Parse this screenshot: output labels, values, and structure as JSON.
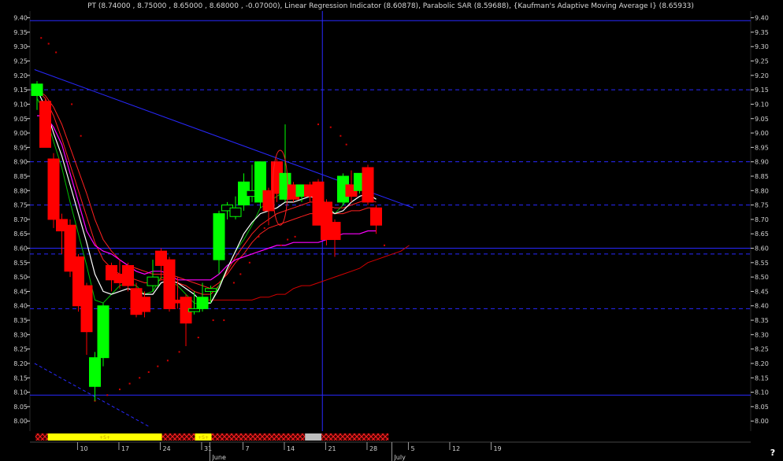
{
  "header": {
    "text": "PT (8.74000 , 8.75000 , 8.65000 , 8.68000 , -0.07000), Linear Regression Indicator (8.60878), Parabolic SAR (8.59688), {Kaufman's Adaptive Moving Average I} (8.65933)"
  },
  "corner_label": "?",
  "colors": {
    "background": "#000000",
    "up_candle": "#00ff00",
    "down_candle": "#ff0000",
    "trendline": "#2828ff",
    "linreg": "#00c000",
    "kama": "#ff00ff",
    "sar": "#d40000",
    "ma_white": "#ffffff",
    "ma_red": "#ff2020",
    "volume_yellow": "#ffff00",
    "volume_gray": "#bdbdbd"
  },
  "chart_data": {
    "type": "candlestick",
    "ylim": [
      7.95,
      9.43
    ],
    "y_ticks": [
      "9.40",
      "9.35",
      "9.30",
      "9.25",
      "9.20",
      "9.15",
      "9.10",
      "9.05",
      "9.00",
      "8.95",
      "8.90",
      "8.85",
      "8.80",
      "8.75",
      "8.70",
      "8.65",
      "8.60",
      "8.55",
      "8.50",
      "8.45",
      "8.40",
      "8.35",
      "8.30",
      "8.25",
      "8.20",
      "8.15",
      "8.10",
      "8.05",
      "8.00"
    ],
    "x_labels": [
      {
        "label": "10",
        "bar": 5
      },
      {
        "label": "17",
        "bar": 10
      },
      {
        "label": "24",
        "bar": 15
      },
      {
        "label": "31",
        "bar": 20
      },
      {
        "label": "June",
        "bar": 21
      },
      {
        "label": "7",
        "bar": 25
      },
      {
        "label": "14",
        "bar": 30
      },
      {
        "label": "21",
        "bar": 35
      },
      {
        "label": "28",
        "bar": 40
      },
      {
        "label": "July",
        "bar": 43
      },
      {
        "label": "5",
        "bar": 45
      },
      {
        "label": "12",
        "bar": 50
      },
      {
        "label": "19",
        "bar": 55
      }
    ],
    "candles": [
      {
        "o": 9.13,
        "h": 9.18,
        "l": 9.08,
        "c": 9.17
      },
      {
        "o": 9.11,
        "h": 9.12,
        "l": 8.95,
        "c": 8.95
      },
      {
        "o": 8.91,
        "h": 8.93,
        "l": 8.67,
        "c": 8.7
      },
      {
        "o": 8.7,
        "h": 8.72,
        "l": 8.58,
        "c": 8.66
      },
      {
        "o": 8.68,
        "h": 8.7,
        "l": 8.5,
        "c": 8.52
      },
      {
        "o": 8.57,
        "h": 8.58,
        "l": 8.38,
        "c": 8.4
      },
      {
        "o": 8.47,
        "h": 8.48,
        "l": 8.23,
        "c": 8.31
      },
      {
        "o": 8.12,
        "h": 8.24,
        "l": 8.07,
        "c": 8.22
      },
      {
        "o": 8.22,
        "h": 8.41,
        "l": 8.19,
        "c": 8.4
      },
      {
        "o": 8.54,
        "h": 8.55,
        "l": 8.45,
        "c": 8.49
      },
      {
        "o": 8.51,
        "h": 8.56,
        "l": 8.46,
        "c": 8.48
      },
      {
        "o": 8.54,
        "h": 8.55,
        "l": 8.45,
        "c": 8.47
      },
      {
        "o": 8.46,
        "h": 8.48,
        "l": 8.36,
        "c": 8.37
      },
      {
        "o": 8.43,
        "h": 8.45,
        "l": 8.36,
        "c": 8.38
      },
      {
        "o": 8.47,
        "h": 8.56,
        "l": 8.45,
        "c": 8.5
      },
      {
        "o": 8.59,
        "h": 8.6,
        "l": 8.49,
        "c": 8.54
      },
      {
        "o": 8.56,
        "h": 8.57,
        "l": 8.38,
        "c": 8.39
      },
      {
        "o": 8.42,
        "h": 8.5,
        "l": 8.39,
        "c": 8.41
      },
      {
        "o": 8.43,
        "h": 8.44,
        "l": 8.26,
        "c": 8.34
      },
      {
        "o": 8.38,
        "h": 8.45,
        "l": 8.37,
        "c": 8.39
      },
      {
        "o": 8.39,
        "h": 8.48,
        "l": 8.38,
        "c": 8.43
      },
      {
        "o": 8.45,
        "h": 8.47,
        "l": 8.41,
        "c": 8.46
      },
      {
        "o": 8.56,
        "h": 8.73,
        "l": 8.51,
        "c": 8.72
      },
      {
        "o": 8.73,
        "h": 8.76,
        "l": 8.7,
        "c": 8.75
      },
      {
        "o": 8.71,
        "h": 8.78,
        "l": 8.7,
        "c": 8.74
      },
      {
        "o": 8.75,
        "h": 8.86,
        "l": 8.73,
        "c": 8.83
      },
      {
        "o": 8.78,
        "h": 8.89,
        "l": 8.76,
        "c": 8.8
      },
      {
        "o": 8.76,
        "h": 8.9,
        "l": 8.74,
        "c": 8.9
      },
      {
        "o": 8.8,
        "h": 8.81,
        "l": 8.68,
        "c": 8.73
      },
      {
        "o": 8.9,
        "h": 8.91,
        "l": 8.76,
        "c": 8.79
      },
      {
        "o": 8.77,
        "h": 9.03,
        "l": 8.76,
        "c": 8.86
      },
      {
        "o": 8.82,
        "h": 8.83,
        "l": 8.76,
        "c": 8.77
      },
      {
        "o": 8.78,
        "h": 8.81,
        "l": 8.76,
        "c": 8.82
      },
      {
        "o": 8.82,
        "h": 8.83,
        "l": 8.76,
        "c": 8.78
      },
      {
        "o": 8.83,
        "h": 8.84,
        "l": 8.68,
        "c": 8.68
      },
      {
        "o": 8.76,
        "h": 8.77,
        "l": 8.61,
        "c": 8.63
      },
      {
        "o": 8.69,
        "h": 8.7,
        "l": 8.57,
        "c": 8.63
      },
      {
        "o": 8.76,
        "h": 8.86,
        "l": 8.75,
        "c": 8.85
      },
      {
        "o": 8.82,
        "h": 8.87,
        "l": 8.76,
        "c": 8.78
      },
      {
        "o": 8.8,
        "h": 8.86,
        "l": 8.79,
        "c": 8.86
      },
      {
        "o": 8.88,
        "h": 8.89,
        "l": 8.75,
        "c": 8.76
      },
      {
        "o": 8.74,
        "h": 8.75,
        "l": 8.65,
        "c": 8.68
      }
    ],
    "linreg": [
      9.12,
      9.07,
      8.97,
      8.88,
      8.76,
      8.65,
      8.54,
      8.42,
      8.41,
      8.44,
      8.47,
      8.48,
      8.47,
      8.44,
      8.45,
      8.5,
      8.49,
      8.47,
      8.44,
      8.41,
      8.4,
      8.41,
      8.47,
      8.53,
      8.59,
      8.63,
      8.68,
      8.74,
      8.76,
      8.78,
      8.8,
      8.8,
      8.8,
      8.81,
      8.79,
      8.75,
      8.72,
      8.75,
      8.79,
      8.81,
      8.79,
      8.77
    ],
    "kama": [
      9.06,
      9.06,
      9.02,
      8.96,
      8.86,
      8.76,
      8.66,
      8.61,
      8.59,
      8.58,
      8.56,
      8.54,
      8.52,
      8.51,
      8.52,
      8.52,
      8.51,
      8.49,
      8.49,
      8.49,
      8.49,
      8.49,
      8.51,
      8.54,
      8.56,
      8.57,
      8.58,
      8.59,
      8.6,
      8.61,
      8.61,
      8.62,
      8.62,
      8.62,
      8.62,
      8.63,
      8.64,
      8.65,
      8.65,
      8.65,
      8.66,
      8.66
    ],
    "ma_white": [
      9.15,
      9.09,
      9.0,
      8.92,
      8.82,
      8.72,
      8.62,
      8.51,
      8.45,
      8.44,
      8.45,
      8.46,
      8.45,
      8.44,
      8.44,
      8.48,
      8.49,
      8.48,
      8.46,
      8.44,
      8.41,
      8.41,
      8.46,
      8.53,
      8.59,
      8.65,
      8.69,
      8.72,
      8.73,
      8.74,
      8.76,
      8.76,
      8.77,
      8.78,
      8.77,
      8.74,
      8.72,
      8.73,
      8.76,
      8.78,
      8.79,
      8.77
    ],
    "ma_red1": [
      9.15,
      9.12,
      9.06,
      8.98,
      8.89,
      8.8,
      8.71,
      8.62,
      8.56,
      8.53,
      8.51,
      8.5,
      8.49,
      8.48,
      8.48,
      8.49,
      8.49,
      8.48,
      8.47,
      8.45,
      8.44,
      8.44,
      8.47,
      8.52,
      8.57,
      8.61,
      8.65,
      8.68,
      8.7,
      8.72,
      8.73,
      8.74,
      8.75,
      8.76,
      8.76,
      8.75,
      8.74,
      8.74,
      8.75,
      8.76,
      8.77,
      8.76
    ],
    "ma_red2": [
      9.15,
      9.13,
      9.09,
      9.03,
      8.95,
      8.87,
      8.79,
      8.7,
      8.63,
      8.59,
      8.56,
      8.54,
      8.53,
      8.52,
      8.51,
      8.51,
      8.51,
      8.5,
      8.49,
      8.48,
      8.47,
      8.46,
      8.48,
      8.51,
      8.55,
      8.58,
      8.62,
      8.65,
      8.67,
      8.68,
      8.69,
      8.7,
      8.71,
      8.72,
      8.72,
      8.72,
      8.72,
      8.72,
      8.73,
      8.73,
      8.74,
      8.74
    ],
    "sar_line": [
      8.42,
      8.42,
      8.42,
      8.42,
      8.42,
      8.42,
      8.42,
      8.43,
      8.43,
      8.44,
      8.44,
      8.46,
      8.47,
      8.47,
      8.48,
      8.49,
      8.5,
      8.51,
      8.52,
      8.53,
      8.55,
      8.56,
      8.57,
      8.58,
      8.59,
      8.61
    ],
    "sar_line_start": 20,
    "sar_dots": [
      {
        "b": 0.5,
        "v": 9.33
      },
      {
        "b": 1.4,
        "v": 9.31
      },
      {
        "b": 2.3,
        "v": 9.28
      },
      {
        "b": 4.2,
        "v": 9.1
      },
      {
        "b": 5.3,
        "v": 8.99
      },
      {
        "b": 7.0,
        "v": 8.07
      },
      {
        "b": 8.5,
        "v": 8.09
      },
      {
        "b": 10.0,
        "v": 8.11
      },
      {
        "b": 11.2,
        "v": 8.13
      },
      {
        "b": 12.4,
        "v": 8.15
      },
      {
        "b": 13.5,
        "v": 8.17
      },
      {
        "b": 14.6,
        "v": 8.19
      },
      {
        "b": 15.8,
        "v": 8.21
      },
      {
        "b": 17.2,
        "v": 8.24
      },
      {
        "b": 19.5,
        "v": 8.29
      },
      {
        "b": 21.3,
        "v": 8.35
      },
      {
        "b": 22.6,
        "v": 8.35
      },
      {
        "b": 23.8,
        "v": 8.48
      },
      {
        "b": 24.6,
        "v": 8.51
      },
      {
        "b": 25.7,
        "v": 8.55
      },
      {
        "b": 26.8,
        "v": 8.64
      },
      {
        "b": 27.5,
        "v": 8.67
      },
      {
        "b": 29.5,
        "v": 8.61
      },
      {
        "b": 30.3,
        "v": 8.63
      },
      {
        "b": 31.2,
        "v": 8.64
      },
      {
        "b": 34.0,
        "v": 9.03
      },
      {
        "b": 35.5,
        "v": 9.02
      },
      {
        "b": 36.7,
        "v": 8.99
      },
      {
        "b": 37.4,
        "v": 8.96
      },
      {
        "b": 42.0,
        "v": 8.61
      }
    ],
    "trendlines": [
      {
        "b1": -0.3,
        "v1": 9.22,
        "b2": 45.5,
        "v2": 8.74,
        "style": "solid"
      },
      {
        "b1": -0.3,
        "v1": 8.2,
        "b2": 13.6,
        "v2": 7.98,
        "style": "dashed"
      }
    ],
    "hlines": [
      {
        "v": 9.39,
        "style": "solid"
      },
      {
        "v": 9.15,
        "style": "dashed"
      },
      {
        "v": 8.9,
        "style": "dashed"
      },
      {
        "v": 8.75,
        "style": "dashed"
      },
      {
        "v": 8.6,
        "style": "solid"
      },
      {
        "v": 8.58,
        "style": "dashed"
      },
      {
        "v": 8.39,
        "style": "dashed"
      },
      {
        "v": 8.09,
        "style": "solid"
      }
    ],
    "vlines": [
      {
        "b": 34.5
      }
    ],
    "ellipse": {
      "b": 29.4,
      "v": 8.81,
      "rb": 0.9,
      "rv": 0.13
    },
    "volume_bar": {
      "segments": [
        {
          "from": 0,
          "to": 1.5,
          "kind": "hatch"
        },
        {
          "from": 1.5,
          "to": 15.3,
          "kind": "yellow",
          "label": "+S+"
        },
        {
          "from": 15.3,
          "to": 19.3,
          "kind": "hatch"
        },
        {
          "from": 19.3,
          "to": 21.3,
          "kind": "yellow",
          "label": "+S+"
        },
        {
          "from": 21.3,
          "to": 32.6,
          "kind": "hatch"
        },
        {
          "from": 32.6,
          "to": 34.6,
          "kind": "gray"
        },
        {
          "from": 34.6,
          "to": 42.7,
          "kind": "hatch"
        }
      ]
    }
  }
}
